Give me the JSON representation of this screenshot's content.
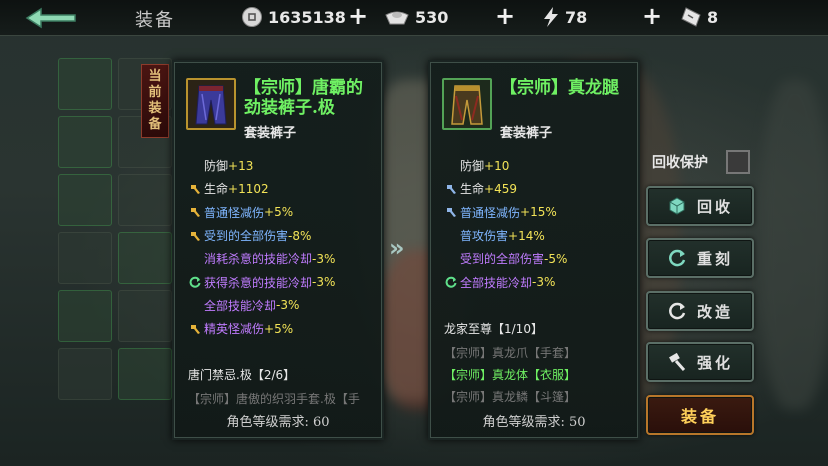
{
  "topbar": {
    "title": "装备",
    "resources": {
      "coin": "1635138",
      "silver": "530",
      "energy": "78",
      "ticket": "8"
    }
  },
  "current_tag": "当前装备",
  "left_item": {
    "name": "【宗师】唐霸的劲装裤子.极",
    "type": "套装裤子",
    "stats": [
      {
        "label": "防御",
        "value": "+13",
        "icon": "none",
        "label_color": "white"
      },
      {
        "label": "生命",
        "value": "+1102",
        "icon": "hammer-gold",
        "label_color": "white"
      },
      {
        "label": "普通怪减伤",
        "value": "+5%",
        "icon": "hammer-gold",
        "label_color": "blue"
      },
      {
        "label": "受到的全部伤害",
        "value": "-8%",
        "icon": "hammer-gold",
        "label_color": "blue"
      },
      {
        "label": "消耗杀意的技能冷却",
        "value": "-3%",
        "icon": "none",
        "label_color": "purple"
      },
      {
        "label": "获得杀意的技能冷却",
        "value": "-3%",
        "icon": "reroll-green",
        "label_color": "purple"
      },
      {
        "label": "全部技能冷却",
        "value": "-3%",
        "icon": "none",
        "label_color": "purple"
      },
      {
        "label": "精英怪减伤",
        "value": "+5%",
        "icon": "hammer-gold",
        "label_color": "purple"
      }
    ],
    "set_title": "唐门禁忌.极【2/6】",
    "set_pieces": [
      {
        "text": "【宗师】唐傲的织羽手套.极【手",
        "active": false
      }
    ],
    "requirement": "角色等级需求: 60"
  },
  "right_item": {
    "name": "【宗师】真龙腿",
    "type": "套装裤子",
    "stats": [
      {
        "label": "防御",
        "value": "+10",
        "icon": "none",
        "label_color": "white"
      },
      {
        "label": "生命",
        "value": "+459",
        "icon": "hammer-blue",
        "label_color": "white"
      },
      {
        "label": "普通怪减伤",
        "value": "+15%",
        "icon": "hammer-blue",
        "label_color": "blue"
      },
      {
        "label": "普攻伤害",
        "value": "+14%",
        "icon": "none",
        "label_color": "blue"
      },
      {
        "label": "受到的全部伤害",
        "value": "-5%",
        "icon": "none",
        "label_color": "purple"
      },
      {
        "label": "全部技能冷却",
        "value": "-3%",
        "icon": "reroll-green",
        "label_color": "purple"
      }
    ],
    "set_title": "龙家至尊【1/10】",
    "set_pieces": [
      {
        "text": "【宗师】真龙爪【手套】",
        "active": false
      },
      {
        "text": "【宗师】真龙体【衣服】",
        "active": true
      },
      {
        "text": "【宗师】真龙鳞【斗篷】",
        "active": false
      }
    ],
    "requirement": "角色等级需求: 50"
  },
  "actions": {
    "protect_label": "回收保护",
    "recycle": "回收",
    "reroll": "重刻",
    "reform": "改造",
    "enhance": "强化",
    "equip": "装备"
  },
  "colors": {
    "name_green": "#6ff063",
    "value_yellow": "#f2e357",
    "label_blue": "#7fb6ff",
    "label_purple": "#c07cff",
    "equip_gold": "#ffd05a"
  }
}
